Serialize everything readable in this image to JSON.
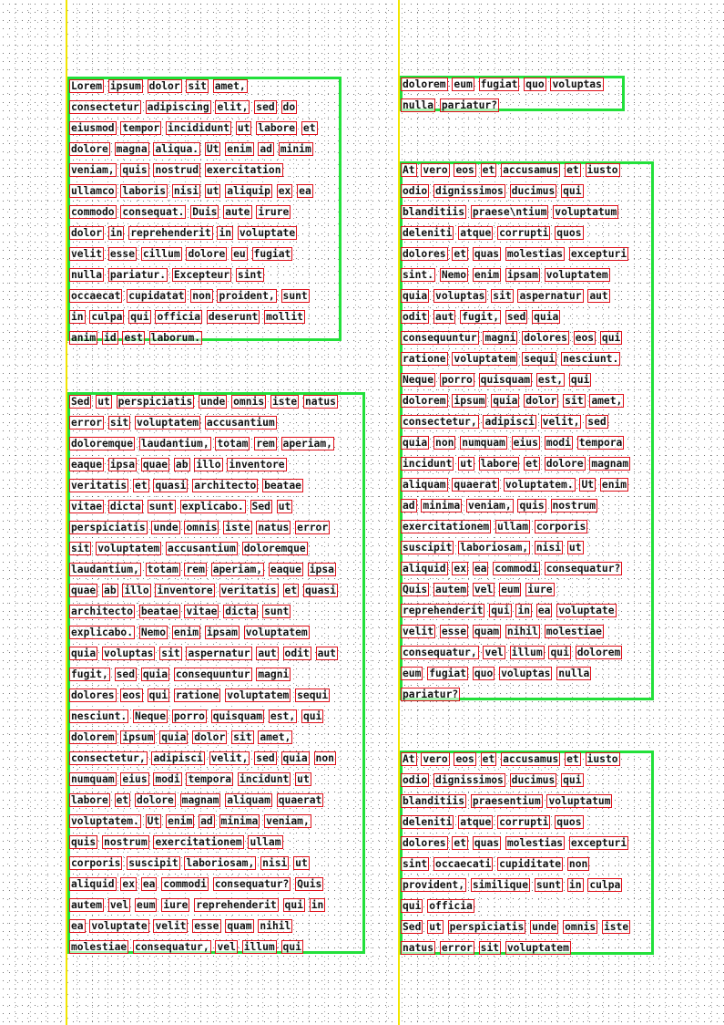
{
  "blocks": [
    {
      "id": "block-1",
      "lines": [
        "Lorem ipsum dolor sit amet,",
        "consectetur adipiscing elit, sed do",
        "eiusmod tempor incididunt ut labore et",
        "dolore magna aliqua. Ut enim ad minim",
        "veniam, quis nostrud exercitation",
        "ullamco laboris nisi ut aliquip ex ea",
        "commodo consequat. Duis aute irure",
        "dolor in reprehenderit in voluptate",
        "velit esse cillum dolore eu fugiat",
        "nulla pariatur. Excepteur sint",
        "occaecat cupidatat non proident, sunt",
        "in culpa qui officia deserunt mollit",
        "anim id est laborum."
      ]
    },
    {
      "id": "block-2",
      "lines": [
        "Sed ut perspiciatis unde omnis iste natus",
        "error sit voluptatem accusantium",
        "doloremque laudantium, totam rem aperiam,",
        "eaque ipsa quae ab illo inventore",
        "veritatis et quasi architecto beatae",
        "vitae dicta sunt explicabo. Sed ut",
        "perspiciatis unde omnis iste natus error",
        "sit voluptatem accusantium doloremque",
        "laudantium, totam rem aperiam, eaque ipsa",
        "quae ab illo inventore veritatis et quasi",
        "architecto beatae vitae dicta sunt",
        "explicabo. Nemo enim ipsam voluptatem",
        "quia voluptas sit aspernatur aut odit aut",
        "fugit, sed quia consequuntur magni",
        "dolores eos qui ratione voluptatem sequi",
        "nesciunt. Neque porro quisquam est, qui",
        "dolorem ipsum quia dolor sit amet,",
        "consectetur, adipisci velit, sed quia non",
        "numquam eius modi tempora incidunt ut",
        "labore et dolore magnam aliquam quaerat",
        "voluptatem. Ut enim ad minima veniam,",
        "quis nostrum exercitationem ullam",
        "corporis suscipit laboriosam, nisi ut",
        "aliquid ex ea commodi consequatur? Quis",
        "autem vel eum iure reprehenderit qui in",
        "ea voluptate velit esse quam nihil",
        "molestiae consequatur, vel illum qui"
      ]
    },
    {
      "id": "block-3",
      "lines": [
        "dolorem eum fugiat quo voluptas",
        "nulla pariatur?"
      ]
    },
    {
      "id": "block-4",
      "lines": [
        "At vero eos et accusamus et iusto",
        "odio dignissimos ducimus qui",
        "blanditiis praese\\ntium voluptatum",
        "deleniti atque corrupti quos",
        "dolores et quas molestias excepturi",
        "sint. Nemo enim ipsam voluptatem",
        "quia voluptas sit aspernatur aut",
        "odit aut fugit, sed quia",
        "consequuntur magni dolores eos qui",
        "ratione voluptatem sequi nesciunt.",
        "Neque porro quisquam est, qui",
        "dolorem ipsum quia dolor sit amet,",
        "consectetur, adipisci velit, sed",
        "quia non numquam eius modi tempora",
        "incidunt ut labore et dolore magnam",
        "aliquam quaerat voluptatem. Ut enim",
        "ad minima veniam, quis nostrum",
        "exercitationem ullam corporis",
        "suscipit laboriosam, nisi ut",
        "aliquid ex ea commodi consequatur?",
        "Quis autem vel eum iure",
        "reprehenderit qui in ea voluptate",
        "velit esse quam nihil molestiae",
        "consequatur, vel illum qui dolorem",
        "eum fugiat quo voluptas nulla",
        "pariatur?"
      ]
    },
    {
      "id": "block-5",
      "lines": [
        "At vero eos et accusamus et iusto",
        "odio dignissimos ducimus qui",
        "blanditiis praesentium voluptatum",
        "deleniti atque corrupti quos",
        "dolores et quas molestias excepturi",
        "sint occaecati cupiditate non",
        "provident, similique sunt in culpa",
        "qui officia",
        "Sed ut perspiciatis unde omnis iste",
        "natus error sit voluptatem"
      ]
    }
  ]
}
